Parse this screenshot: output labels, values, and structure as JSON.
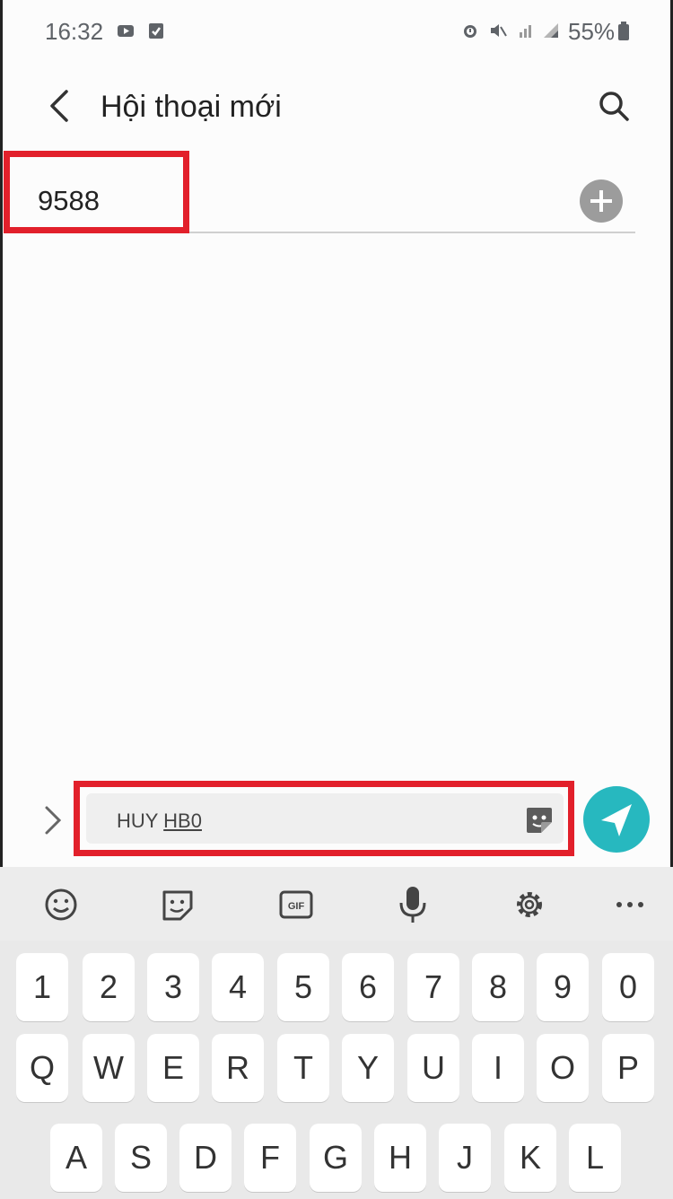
{
  "status_bar": {
    "time": "16:32",
    "battery": "55%",
    "icons": [
      "youtube-icon",
      "task-icon",
      "alarm-icon",
      "mute-icon",
      "wifi-icon",
      "signal-icon",
      "battery-icon"
    ]
  },
  "header": {
    "title": "Hội thoại mới",
    "back_icon": "chevron-left-icon",
    "search_icon": "search-icon"
  },
  "recipient": {
    "value": "9588",
    "add_icon": "plus-circle-icon"
  },
  "composer": {
    "text_plain": "HUY ",
    "text_underlined": "HB0",
    "expand_icon": "chevron-right-icon",
    "sticker_icon": "sticker-icon",
    "send_icon": "send-icon",
    "send_color": "#27b8bf"
  },
  "keyboard": {
    "toolbar": [
      "emoji-icon",
      "sticker-icon",
      "gif-icon",
      "microphone-icon",
      "settings-icon",
      "more-icon"
    ],
    "rows": [
      [
        "1",
        "2",
        "3",
        "4",
        "5",
        "6",
        "7",
        "8",
        "9",
        "0"
      ],
      [
        "Q",
        "W",
        "E",
        "R",
        "T",
        "Y",
        "U",
        "I",
        "O",
        "P"
      ],
      [
        "A",
        "S",
        "D",
        "F",
        "G",
        "H",
        "J",
        "K",
        "L"
      ]
    ]
  },
  "highlight_color": "#e2202b"
}
